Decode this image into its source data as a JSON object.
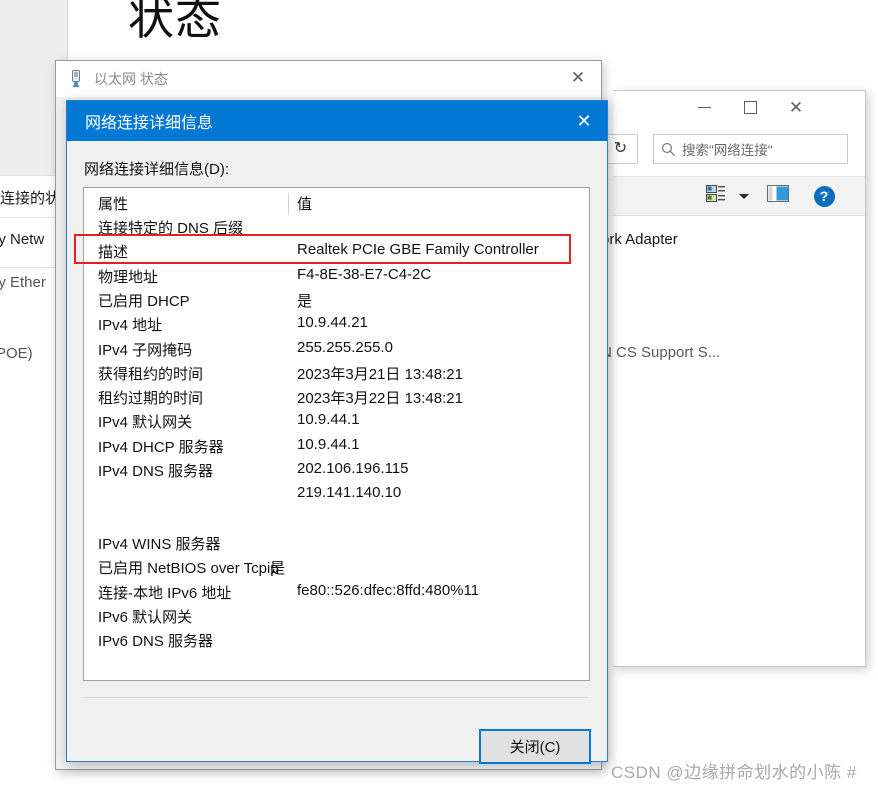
{
  "background": {
    "big_title": "状态",
    "left_items": [
      "连接的状态",
      "ly Netw",
      "ly Ether",
      "POE)"
    ],
    "window": {
      "minimize_label": "—",
      "maximize_label": "□",
      "close_label": "✕",
      "refresh_label": "↻",
      "search_placeholder": "搜索\"网络连接\"",
      "toolbar": {
        "view_mode_label": "view-mode",
        "caret_label": "▾",
        "preview_pane_label": "preview-pane",
        "help_label": "?"
      },
      "body_lines": [
        "ork Adapter",
        "N CS Support S..."
      ]
    }
  },
  "eth_status_dialog": {
    "title": "以太网 状态",
    "close_label": "✕",
    "icon": "ethernet-connector-icon"
  },
  "details_dialog": {
    "title": "网络连接详细信息",
    "close_label": "✕",
    "section_label": "网络连接详细信息(D):",
    "columns": {
      "property": "属性",
      "value": "值"
    },
    "rows": [
      {
        "property": "连接特定的 DNS 后缀",
        "value": ""
      },
      {
        "property": "描述",
        "value": "Realtek PCIe GBE Family Controller",
        "highlighted": true
      },
      {
        "property": "物理地址",
        "value": "F4-8E-38-E7-C4-2C"
      },
      {
        "property": "已启用 DHCP",
        "value": "是"
      },
      {
        "property": "IPv4 地址",
        "value": "10.9.44.21"
      },
      {
        "property": "IPv4 子网掩码",
        "value": "255.255.255.0"
      },
      {
        "property": "获得租约的时间",
        "value": "2023年3月21日 13:48:21"
      },
      {
        "property": "租约过期的时间",
        "value": "2023年3月22日 13:48:21"
      },
      {
        "property": "IPv4 默认网关",
        "value": "10.9.44.1"
      },
      {
        "property": "IPv4 DHCP 服务器",
        "value": "10.9.44.1"
      },
      {
        "property": "IPv4 DNS 服务器",
        "value": "202.106.196.115"
      },
      {
        "property": "",
        "value": "219.141.140.10"
      },
      {
        "property": "",
        "value": ""
      },
      {
        "property": "IPv4 WINS 服务器",
        "value": ""
      },
      {
        "property": "已启用 NetBIOS over Tcpip",
        "value": "是",
        "value_inline": true
      },
      {
        "property": "连接-本地 IPv6 地址",
        "value": "fe80::526:dfec:8ffd:480%11"
      },
      {
        "property": "IPv6 默认网关",
        "value": ""
      },
      {
        "property": "IPv6 DNS 服务器",
        "value": ""
      }
    ],
    "close_button_label": "关闭(C)"
  },
  "annotation": {
    "highlight_color": "#e02222",
    "accent_color": "#0078d4"
  },
  "watermark": {
    "text": "CSDN @边缘拼命划水的小陈 #"
  }
}
